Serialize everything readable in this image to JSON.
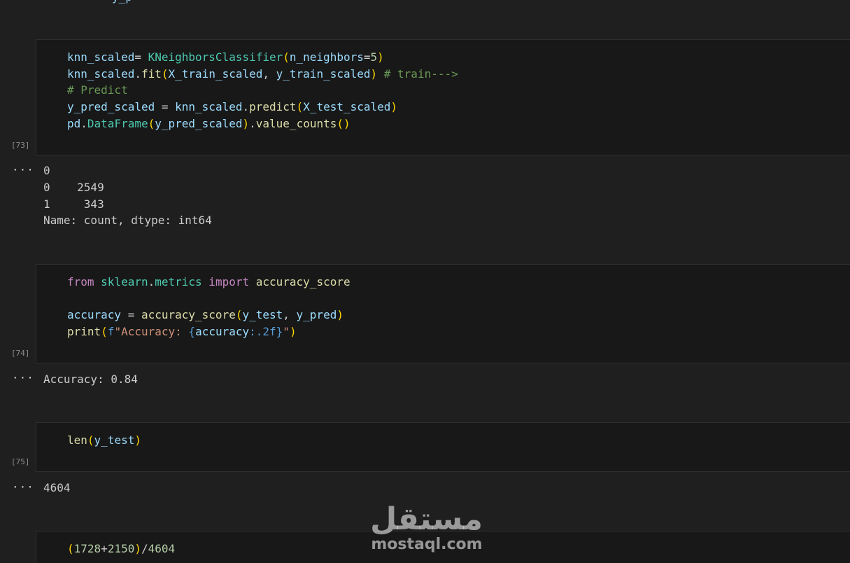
{
  "partial_top_line": "y_p",
  "cells": [
    {
      "exec_count": "[73]",
      "lines": {
        "l1_a": "knn_scaled",
        "l1_b": "= ",
        "l1_c": "KNeighborsClassifier",
        "l1_d": "(",
        "l1_e": "n_neighbors",
        "l1_f": "=",
        "l1_g": "5",
        "l1_h": ")",
        "l2_a": "knn_scaled",
        "l2_b": ".",
        "l2_c": "fit",
        "l2_d": "(",
        "l2_e": "X_train_scaled",
        "l2_f": ", ",
        "l2_g": "y_train_scaled",
        "l2_h": ")",
        "l2_i": " # train--->",
        "l3": "# Predict",
        "l4_a": "y_pred_scaled",
        "l4_b": " = ",
        "l4_c": "knn_scaled",
        "l4_d": ".",
        "l4_e": "predict",
        "l4_f": "(",
        "l4_g": "X_test_scaled",
        "l4_h": ")",
        "l5_a": "pd",
        "l5_b": ".",
        "l5_c": "DataFrame",
        "l5_d": "(",
        "l5_e": "y_pred_scaled",
        "l5_f": ")",
        "l5_g": ".",
        "l5_h": "value_counts",
        "l5_i": "()"
      },
      "output": [
        "0",
        "0    2549",
        "1     343",
        "Name: count, dtype: int64"
      ]
    },
    {
      "exec_count": "[74]",
      "lines": {
        "l1_a": "from",
        "l1_b": " sklearn",
        "l1_c": ".",
        "l1_d": "metrics",
        "l1_e": " import",
        "l1_f": " accuracy_score",
        "l3_a": "accuracy",
        "l3_b": " = ",
        "l3_c": "accuracy_score",
        "l3_d": "(",
        "l3_e": "y_test",
        "l3_f": ", ",
        "l3_g": "y_pred",
        "l3_h": ")",
        "l4_a": "print",
        "l4_b": "(",
        "l4_c": "f",
        "l4_d": "\"Accuracy: ",
        "l4_e": "{",
        "l4_f": "accuracy",
        "l4_g": ":.2f",
        "l4_h": "}",
        "l4_i": "\"",
        "l4_j": ")"
      },
      "output": [
        "Accuracy: 0.84"
      ]
    },
    {
      "exec_count": "[75]",
      "lines": {
        "l1_a": "len",
        "l1_b": "(",
        "l1_c": "y_test",
        "l1_d": ")"
      },
      "output": [
        "4604"
      ]
    },
    {
      "lines": {
        "l1_a": "(",
        "l1_b": "1728",
        "l1_c": "+",
        "l1_d": "2150",
        "l1_e": ")",
        "l1_f": "/",
        "l1_g": "4604"
      }
    }
  ],
  "output_menu_icon": "ellipsis-icon",
  "output_menu_glyph": "···",
  "watermark": {
    "logo_text": "مستقل",
    "url": "mostaql.com"
  },
  "colors": {
    "background": "#1f1f1f",
    "cell_background": "#181818",
    "variable": "#9cdcfe",
    "class": "#4ec9b0",
    "function": "#dcdcaa",
    "number": "#b5cea8",
    "string": "#ce9178",
    "comment": "#6a9955",
    "keyword": "#c586c0",
    "bracket": "#ffd700"
  }
}
